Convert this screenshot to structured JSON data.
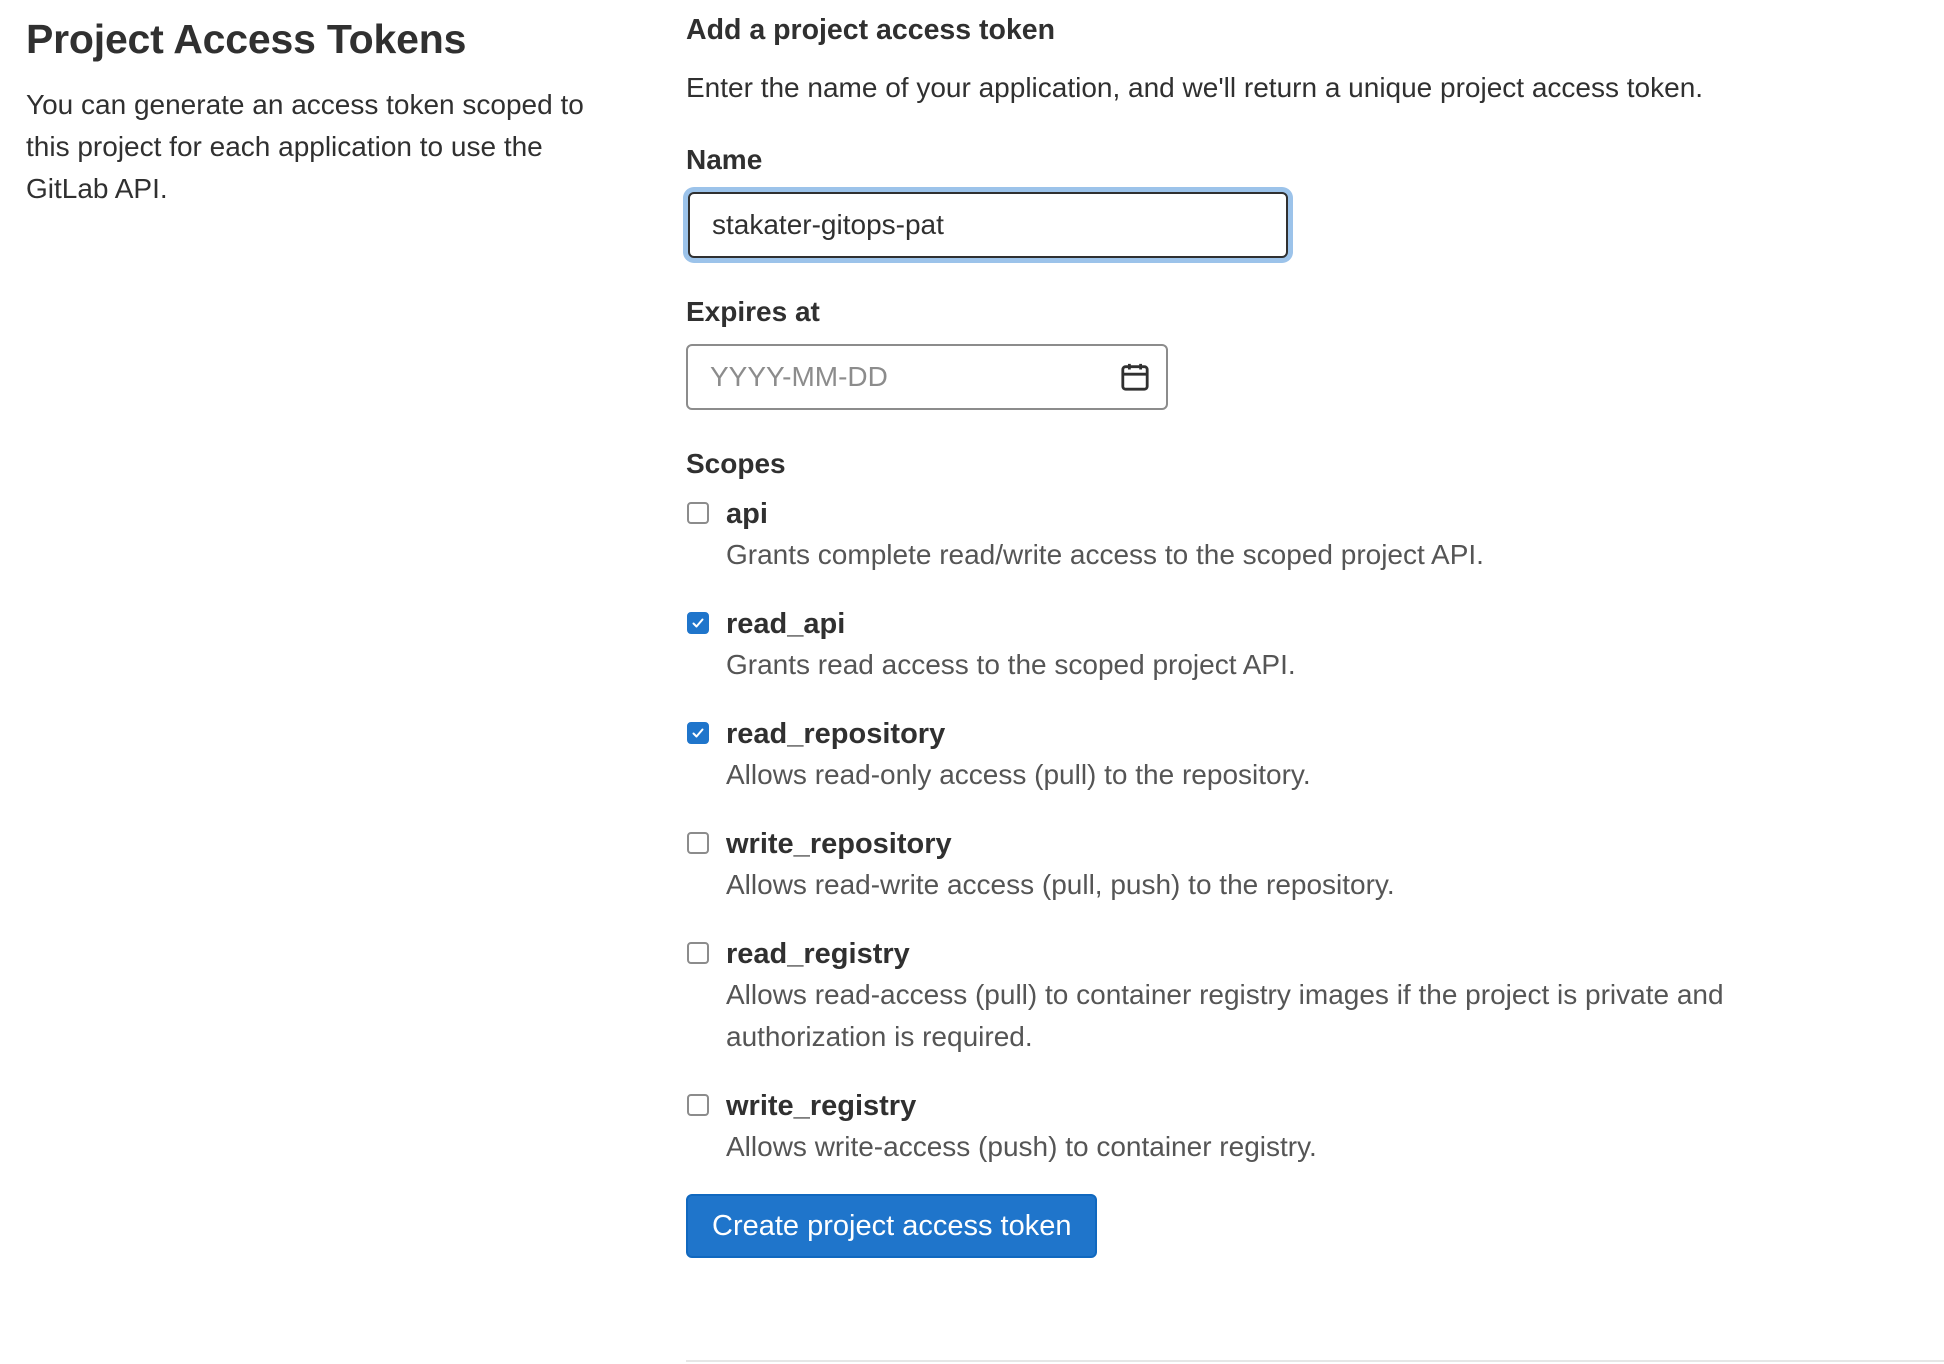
{
  "section": {
    "title": "Project Access Tokens",
    "description": "You can generate an access token scoped to this project for each application to use the GitLab API."
  },
  "form": {
    "heading": "Add a project access token",
    "intro": "Enter the name of your application, and we'll return a unique project access token.",
    "name_label": "Name",
    "name_value": "stakater-gitops-pat",
    "expires_label": "Expires at",
    "expires_placeholder": "YYYY-MM-DD",
    "expires_icon": "calendar-icon",
    "scopes_label": "Scopes",
    "scopes": [
      {
        "name": "api",
        "description": "Grants complete read/write access to the scoped project API.",
        "checked": false
      },
      {
        "name": "read_api",
        "description": "Grants read access to the scoped project API.",
        "checked": true
      },
      {
        "name": "read_repository",
        "description": "Allows read-only access (pull) to the repository.",
        "checked": true
      },
      {
        "name": "write_repository",
        "description": "Allows read-write access (pull, push) to the repository.",
        "checked": false
      },
      {
        "name": "read_registry",
        "description": "Allows read-access (pull) to container registry images if the project is private and authorization is required.",
        "checked": false
      },
      {
        "name": "write_registry",
        "description": "Allows write-access (push) to container registry.",
        "checked": false
      }
    ],
    "submit_label": "Create project access token"
  },
  "colors": {
    "primary": "#1f75cb",
    "text": "#303030",
    "muted": "#555555",
    "focus_ring": "#9cc3ea"
  }
}
